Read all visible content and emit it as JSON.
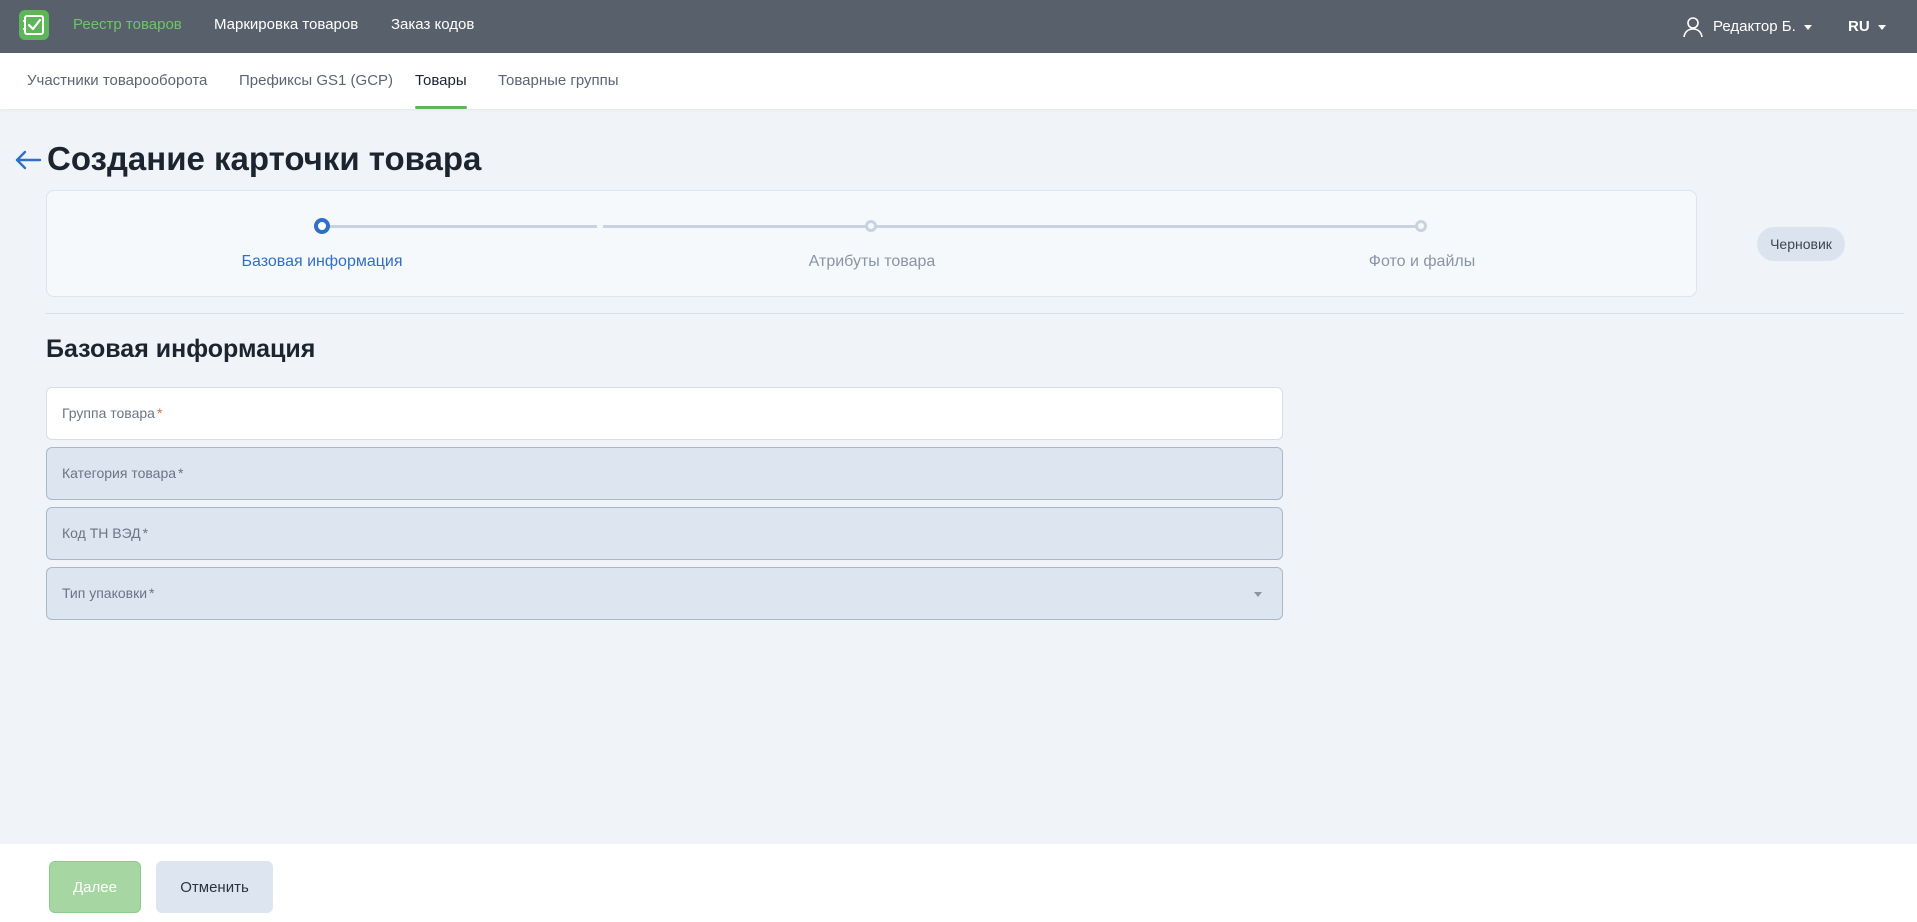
{
  "header": {
    "logo_icon": "checklist-icon",
    "brand_color": "#5fb65a",
    "nav": [
      {
        "label": "Реестр товаров",
        "active": true
      },
      {
        "label": "Маркировка товаров",
        "active": false
      },
      {
        "label": "Заказ кодов",
        "active": false
      }
    ],
    "user": {
      "icon": "user-icon",
      "label": "Редактор Б."
    },
    "language": "RU"
  },
  "subnav": {
    "tabs": [
      {
        "label": "Участники товарооборота",
        "active": false
      },
      {
        "label": "Префиксы GS1 (GCP)",
        "active": false
      },
      {
        "label": "Товары",
        "active": true
      },
      {
        "label": "Товарные группы",
        "active": false
      }
    ]
  },
  "page": {
    "back_icon": "arrow-left-icon",
    "title": "Создание карточки товара",
    "status": "Черновик"
  },
  "stepper": {
    "steps": [
      {
        "label": "Базовая информация",
        "active": true
      },
      {
        "label": "Атрибуты товара",
        "active": false
      },
      {
        "label": "Фото и файлы",
        "active": false
      }
    ]
  },
  "form": {
    "section_title": "Базовая информация",
    "required_mark": "*",
    "fields": [
      {
        "label": "Группа товара",
        "value": "",
        "disabled": false,
        "type": "input"
      },
      {
        "label": "Категория товара",
        "value": "",
        "disabled": true,
        "type": "input"
      },
      {
        "label": "Код ТН ВЭД",
        "value": "",
        "disabled": true,
        "type": "input"
      },
      {
        "label": "Тип упаковки",
        "value": "",
        "disabled": true,
        "type": "select"
      }
    ]
  },
  "footer": {
    "next_label": "Далее",
    "cancel_label": "Отменить"
  }
}
